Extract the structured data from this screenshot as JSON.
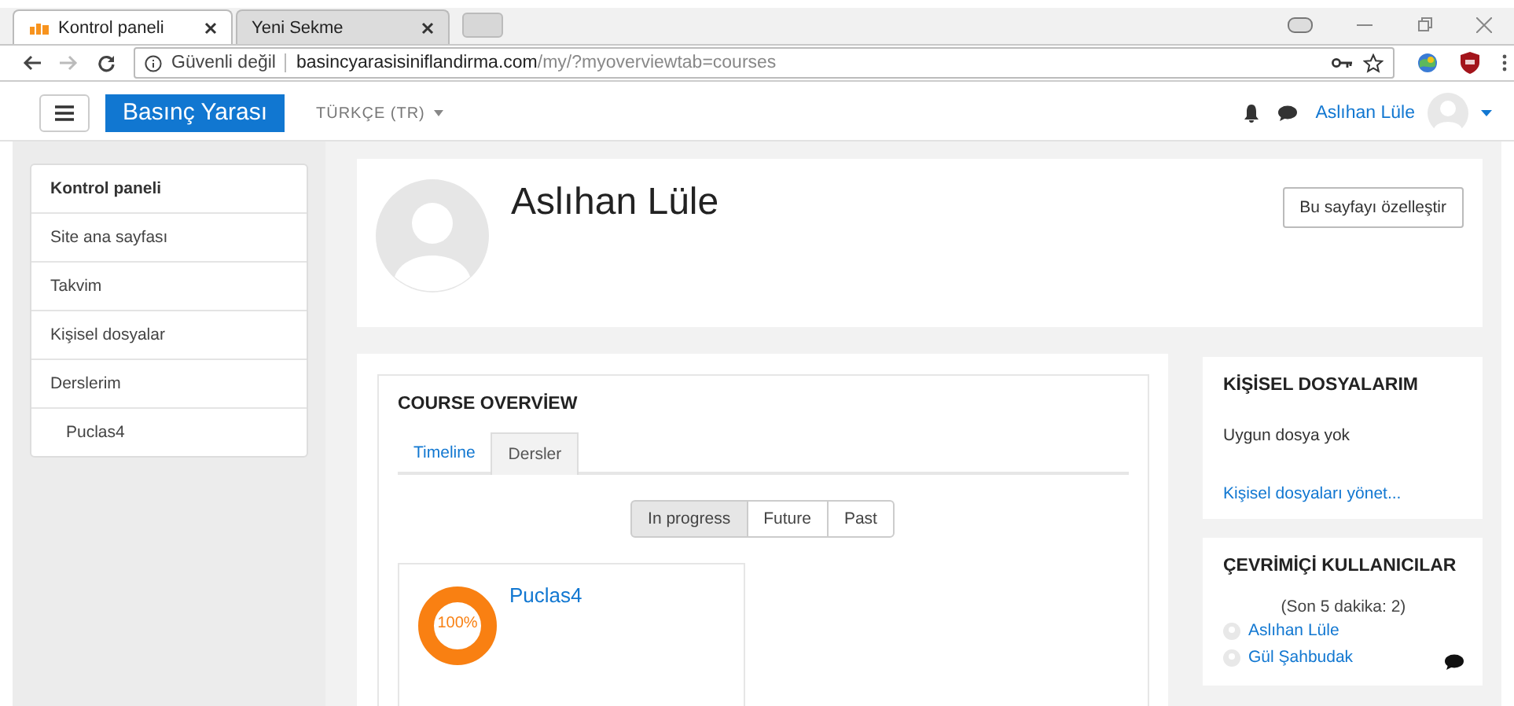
{
  "browser": {
    "tabs": [
      {
        "label": "Kontrol paneli",
        "selected": true
      },
      {
        "label": "Yeni Sekme",
        "selected": false
      }
    ],
    "security": "Güvenli değil",
    "url": "**basincyarasisiniflandirma.com**/my/?myoverviewtab=courses"
  },
  "navbar": {
    "site_name": "Basınç Yarası",
    "language": "TÜRKÇE (TR)",
    "user_name": "Aslıhan Lüle"
  },
  "sidebar": {
    "items": [
      {
        "label": "Kontrol paneli",
        "selected": true
      },
      {
        "label": "Site ana sayfası",
        "selected": false
      },
      {
        "label": "Takvim",
        "selected": false
      },
      {
        "label": "Kişisel dosyalar",
        "selected": false
      },
      {
        "label": "Derslerim",
        "selected": false,
        "children": [
          {
            "label": "Puclas4",
            "selected": false
          }
        ]
      }
    ]
  },
  "profile": {
    "name": "Aslıhan Lüle",
    "customize_button": "Bu sayfayı özelleştir"
  },
  "course_overview": {
    "title": "COURSE OVERVİEW",
    "tabs": [
      {
        "label": "Timeline",
        "selected": false
      },
      {
        "label": "Dersler",
        "selected": true
      }
    ],
    "filters": [
      {
        "label": "In progress",
        "selected": true
      },
      {
        "label": "Future",
        "selected": false
      },
      {
        "label": "Past",
        "selected": false
      }
    ],
    "courses": [
      {
        "name": "Puclas4",
        "progress": "100%",
        "level": 1
      }
    ]
  },
  "private_files": {
    "title": "KİŞİSEL DOSYALARIM",
    "message": "Uygun dosya yok",
    "link": "Kişisel dosyaları yönet..."
  },
  "online_users": {
    "title": "ÇEVRİMİÇİ KULLANICILAR",
    "summary": "(Son 5 dakika: 2)",
    "users": [
      {
        "name": "Aslıhan Lüle",
        "message_icon": false
      },
      {
        "name": "Gül Şahbudak",
        "message_icon": true
      }
    ]
  }
}
